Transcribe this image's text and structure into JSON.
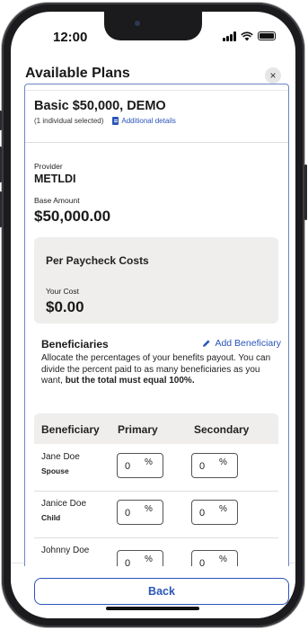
{
  "status": {
    "time": "12:00"
  },
  "header": {
    "title": "Available Plans",
    "close": "×"
  },
  "plan": {
    "title": "Basic $50,000, DEMO",
    "selected": "(1 individual selected)",
    "details_link": "Additional details",
    "provider_label": "Provider",
    "provider": "METLDI",
    "base_label": "Base Amount",
    "base_amount": "$50,000.00"
  },
  "costs": {
    "title": "Per Paycheck Costs",
    "your_cost_label": "Your Cost",
    "your_cost": "$0.00"
  },
  "beneficiaries": {
    "title": "Beneficiaries",
    "add_label": "Add Beneficiary",
    "desc_plain": "Allocate the percentages of your benefits payout. You can divide the percent paid to as many beneficiaries as you want, ",
    "desc_bold": "but the total must equal 100%.",
    "columns": [
      "Beneficiary",
      "Primary",
      "Secondary"
    ],
    "rows": [
      {
        "name": "Jane Doe",
        "relation": "Spouse",
        "primary": "0",
        "secondary": "0"
      },
      {
        "name": "Janice Doe",
        "relation": "Child",
        "primary": "0",
        "secondary": "0"
      },
      {
        "name": "Johnny Doe",
        "relation": "",
        "primary": "0",
        "secondary": "0"
      }
    ],
    "pct_symbol": "%"
  },
  "footer": {
    "back_label": "Back"
  },
  "colors": {
    "accent": "#2a55b8",
    "card_border": "#6b86c7",
    "panel_bg": "#efeeec"
  }
}
